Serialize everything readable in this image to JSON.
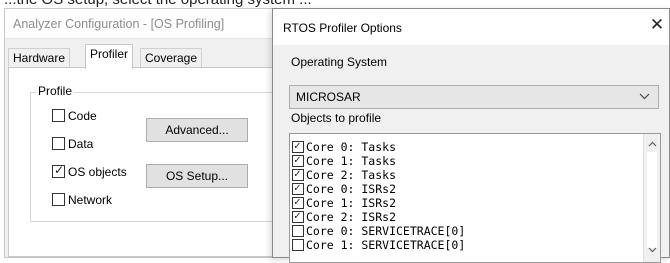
{
  "background_caption": "...the OS setup, select the operating system ...",
  "analyzer_window": {
    "title": "Analyzer Configuration - [OS Profiling]",
    "tabs": [
      {
        "label": "Hardware",
        "active": false
      },
      {
        "label": "Profiler",
        "active": true
      },
      {
        "label": "Coverage",
        "active": false
      }
    ],
    "profile_group_label": "Profile",
    "checkboxes": [
      {
        "label": "Code",
        "checked": false
      },
      {
        "label": "Data",
        "checked": false
      },
      {
        "label": "OS objects",
        "checked": true
      },
      {
        "label": "Network",
        "checked": false
      }
    ],
    "advanced_button": "Advanced...",
    "os_setup_button": "OS Setup..."
  },
  "dialog": {
    "title": "RTOS Profiler Options",
    "close_glyph": "✕",
    "os_label": "Operating System",
    "os_value": "MICROSAR",
    "objects_label": "Objects to profile",
    "objects": [
      {
        "label": "Core 0: Tasks",
        "checked": true
      },
      {
        "label": "Core 1: Tasks",
        "checked": true
      },
      {
        "label": "Core 2: Tasks",
        "checked": true
      },
      {
        "label": "Core 0: ISRs2",
        "checked": true
      },
      {
        "label": "Core 1: ISRs2",
        "checked": true
      },
      {
        "label": "Core 2: ISRs2",
        "checked": true
      },
      {
        "label": "Core 0: SERVICETRACE[0]",
        "checked": false
      },
      {
        "label": "Core 1: SERVICETRACE[0]",
        "checked": false
      }
    ]
  },
  "icons": {
    "combo_chevron": "chevron-down-icon",
    "scroll_up": "chevron-up-icon",
    "scroll_down": "chevron-down-icon",
    "check": "check-icon"
  }
}
